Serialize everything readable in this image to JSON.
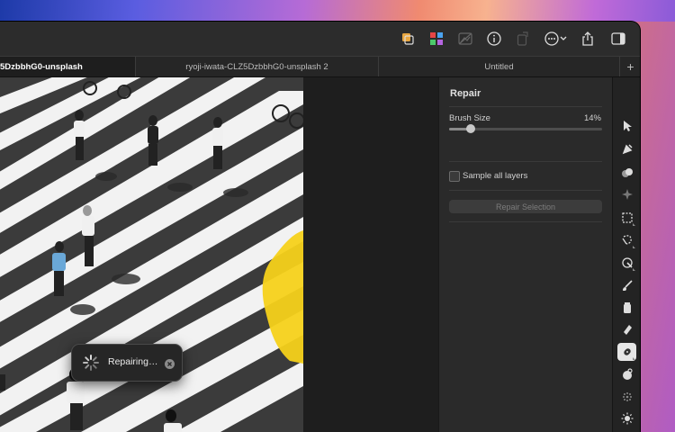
{
  "tabs": [
    {
      "label": "5DzbbhG0-unsplash",
      "active": true
    },
    {
      "label": "ryoji-iwata-CLZ5DzbbhG0-unsplash 2",
      "active": false
    },
    {
      "label": "Untitled",
      "active": false
    }
  ],
  "tab_add": "+",
  "toolbar_icons": [
    "layers-icon",
    "color-swatch-icon",
    "image-mask-icon",
    "info-icon",
    "export-icon",
    "more-icon",
    "share-icon",
    "sidebar-toggle-icon"
  ],
  "panel": {
    "title": "Repair",
    "brush_size_label": "Brush Size",
    "brush_size_value": "14%",
    "brush_size_fraction": 0.14,
    "sample_all_layers_label": "Sample all layers",
    "sample_all_layers_checked": false,
    "repair_selection_label": "Repair Selection"
  },
  "toast": {
    "label": "Repairing…"
  },
  "tools": [
    "pointer-icon",
    "pen-icon",
    "color-adjust-icon",
    "sparkle-icon",
    "rect-select-icon",
    "lasso-icon",
    "magic-wand-icon",
    "brush-icon",
    "paint-bucket-icon",
    "eraser-icon",
    "repair-icon",
    "clone-icon",
    "blur-icon",
    "sun-icon",
    "smudge-icon"
  ],
  "active_tool": "repair-icon",
  "colors": {
    "accent_highlight": "#f6d11a",
    "window_bg": "#1e1e1e",
    "panel_bg": "#2a2a2a"
  }
}
